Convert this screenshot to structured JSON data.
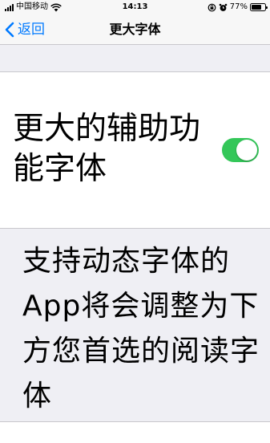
{
  "status_bar": {
    "carrier": "中国移动",
    "time": "14:13",
    "battery_percent": "77%",
    "battery_level": 0.77,
    "icons": [
      "signal-icon",
      "wifi-icon",
      "orientation-lock-icon",
      "alarm-icon",
      "battery-icon"
    ]
  },
  "nav": {
    "back_label": "返回",
    "title": "更大字体",
    "accent_color": "#007aff"
  },
  "setting": {
    "label": "更大的辅助功能字体",
    "toggle_on": true,
    "toggle_color": "#34c759"
  },
  "description": "支持动态字体的App将会调整为下方您首选的阅读字体"
}
